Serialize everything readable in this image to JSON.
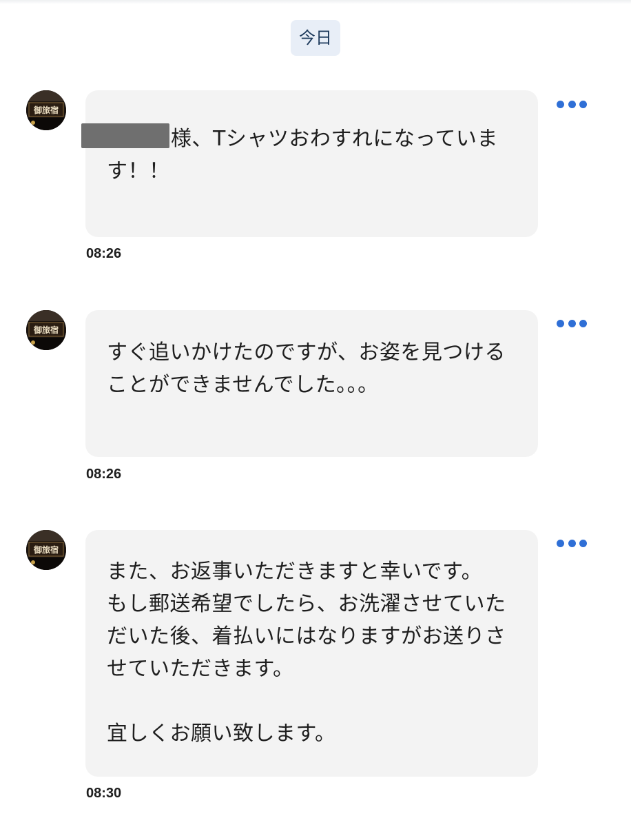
{
  "date_separator": "今日",
  "messages": [
    {
      "lines": [
        "様、Tシャツおわすれになっていま",
        "す！！"
      ],
      "time": "08:26"
    },
    {
      "lines": [
        "すぐ追いかけたのですが、お姿を見つける",
        "ことができませんでした。。。"
      ],
      "time": "08:26"
    },
    {
      "lines": [
        "また、お返事いただきますと幸いです。",
        "もし郵送希望でしたら、お洗濯させていた",
        "だいた後、着払いにはなりますがお送りさ",
        "せていただきます。",
        "",
        "宜しくお願い致します。"
      ],
      "time": "08:30"
    }
  ],
  "sender_avatar": {
    "sign_text": "御旅宿"
  },
  "colors": {
    "bubble_bg": "#f3f3f3",
    "chip_bg": "#e8eef7",
    "chip_text": "#1d3a5c",
    "more_dots": "#2f6fd6",
    "text": "#1e1e1e"
  },
  "icons": {
    "more": "more-horizontal-icon"
  }
}
